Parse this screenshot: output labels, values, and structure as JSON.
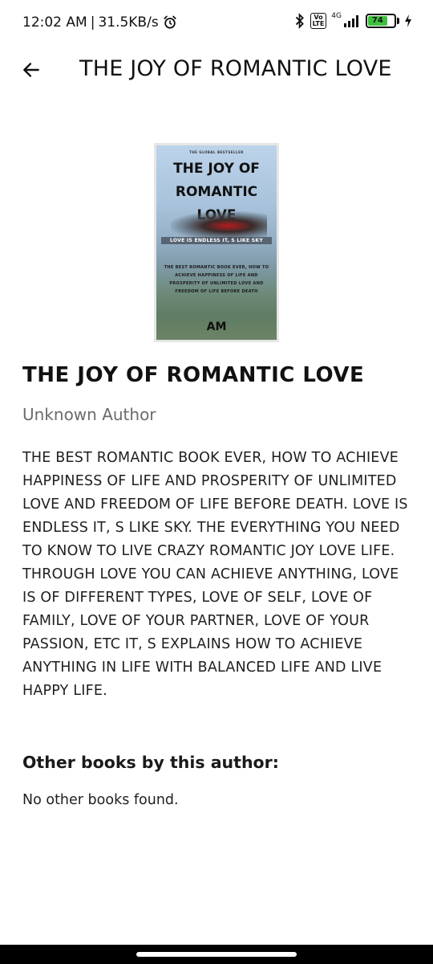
{
  "status_bar": {
    "time": "12:02 AM",
    "separator": "|",
    "net_speed": "31.5KB/s",
    "network_type": "4G",
    "volte_label": "Vo\nLTE",
    "battery_level": "74",
    "icons": [
      "alarm-icon",
      "bluetooth-icon",
      "signal-icon",
      "battery-icon",
      "charging-icon"
    ]
  },
  "app_bar": {
    "title": "THE JOY OF ROMANTIC LOVE",
    "back_icon": "arrow-left-icon"
  },
  "cover": {
    "bestseller": "THE GLOBAL BESTSELLER",
    "title": "THE JOY OF\nROMANTIC\nLOVE",
    "tagline": "LOVE IS ENDLESS IT, S LIKE SKY",
    "blurb": "THE BEST ROMANTIC BOOK EVER, HOW TO ACHIEVE HAPPINESS OF LIFE AND PROSPERITY OF UNLIMITED LOVE AND FREEDOM OF LIFE BEFORE DEATH",
    "author": "AM"
  },
  "book": {
    "title": "THE JOY OF ROMANTIC LOVE",
    "author": "Unknown Author",
    "description": "THE BEST ROMANTIC BOOK EVER, HOW TO ACHIEVE HAPPINESS OF LIFE AND PROSPERITY OF UNLIMITED LOVE AND FREEDOM OF LIFE BEFORE DEATH. LOVE IS ENDLESS IT, S LIKE SKY. THE EVERYTHING YOU NEED TO KNOW TO LIVE CRAZY ROMANTIC JOY LOVE LIFE. THROUGH LOVE YOU CAN ACHIEVE ANYTHING, LOVE IS OF DIFFERENT TYPES, LOVE OF SELF, LOVE OF FAMILY, LOVE OF YOUR PARTNER, LOVE OF YOUR PASSION, ETC IT, S EXPLAINS HOW TO ACHIEVE ANYTHING IN LIFE WITH BALANCED LIFE AND LIVE HAPPY LIFE."
  },
  "other_books": {
    "heading": "Other books by this author:",
    "empty_message": "No other books found."
  },
  "colors": {
    "background": "#ffffff",
    "text": "#1a1a1a",
    "secondary_text": "#6b6b6b",
    "battery_fill": "#3ec13e",
    "nav_bar": "#000000"
  }
}
